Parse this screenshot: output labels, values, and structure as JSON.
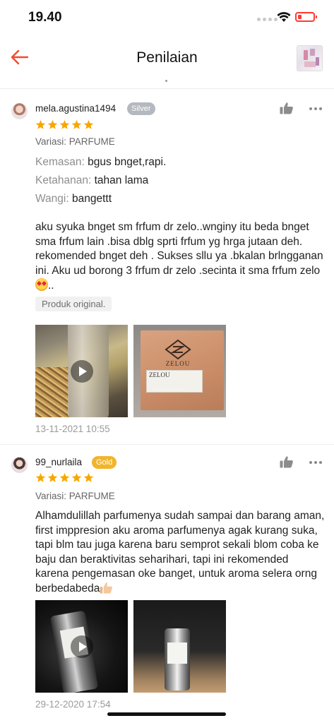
{
  "status_bar": {
    "time": "19.40",
    "battery_color": "#ff3b30"
  },
  "nav": {
    "back_icon": "arrow-left-icon",
    "title": "Penilaian",
    "accent_color": "#ee4d2d"
  },
  "reviews": [
    {
      "username": "mela.agustina1494",
      "badge": "Silver",
      "rating": 5,
      "variant": "Variasi: PARFUME",
      "attributes": [
        {
          "key": "Kemasan:",
          "value": "bgus bnget,rapi."
        },
        {
          "key": "Ketahanan:",
          "value": "tahan lama"
        },
        {
          "key": "Wangi:",
          "value": "bangettt"
        }
      ],
      "text": "aku syuka bnget sm  frfum dr zelo..wnginy itu beda bnget sma frfum lain .bisa dblg sprti frfum yg hrga jutaan deh. rekomended bnget deh . Sukses sllu ya .bkalan brlngganan ini. Aku ud borong 3 frfum dr zelo .secinta it sma frfum zelo",
      "text_suffix": "..",
      "tag": "Produk original.",
      "media_brand": "ZELOU",
      "media_label": "ZELOU",
      "timestamp": "13-11-2021 10:55"
    },
    {
      "username": "99_nurlaila",
      "badge": "Gold",
      "rating": 5,
      "variant": "Variasi: PARFUME",
      "text": "Alhamdulillah parfumenya sudah sampai dan barang aman, first imppresion aku aroma parfumenya agak kurang suka, tapi blm tau juga karena baru semprot sekali blom coba ke baju dan beraktivitas seharihari, tapi ini rekomended karena pengemasan oke banget, untuk aroma selera orng berbedabeda",
      "timestamp": "29-12-2020 17:54"
    }
  ],
  "colors": {
    "star": "#f6a700",
    "silver_badge": "#b4b8bf",
    "gold_badge": "#f0b52b"
  }
}
